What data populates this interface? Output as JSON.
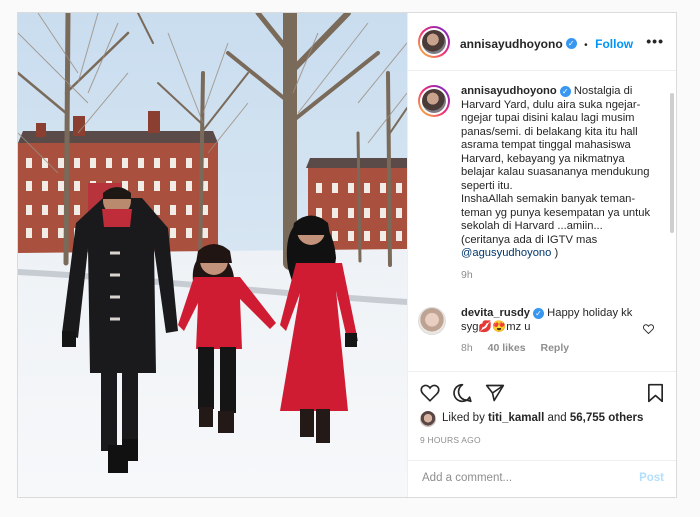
{
  "header": {
    "username": "annisayudhoyono",
    "follow_label": "Follow",
    "separator": "•",
    "more_label": "•••"
  },
  "caption": {
    "username": "annisayudhoyono",
    "text": "Nostalgia di Harvard Yard, dulu aira suka ngejar-ngejar tupai disini kalau lagi musim panas/semi. di belakang kita itu hall asrama tempat tinggal mahasiswa Harvard, kebayang ya nikmatnya belajar kalau suasananya mendukung seperti itu.",
    "text2": "InshaAllah semakin banyak teman-teman yg punya kesempatan ya untuk sekolah di Harvard ...amiin... (ceritanya ada di IGTV mas",
    "mention": "@agusyudhoyono",
    "text2_end": ")",
    "time": "9h"
  },
  "comment": {
    "username": "devita_rusdy",
    "text": "Happy holiday kk syg💋😍mz u",
    "time": "8h",
    "likes": "40 likes",
    "reply_label": "Reply"
  },
  "likes": {
    "prefix": "Liked by",
    "user": "titi_kamall",
    "middle": "and",
    "count": "56,755 others"
  },
  "timestamp": "9 HOURS AGO",
  "add_comment": {
    "placeholder": "Add a comment...",
    "post_label": "Post"
  },
  "colors": {
    "accent": "#0095f6",
    "verified": "#3897f0",
    "coat_red": "#d01c33",
    "brick": "#a9503f"
  }
}
